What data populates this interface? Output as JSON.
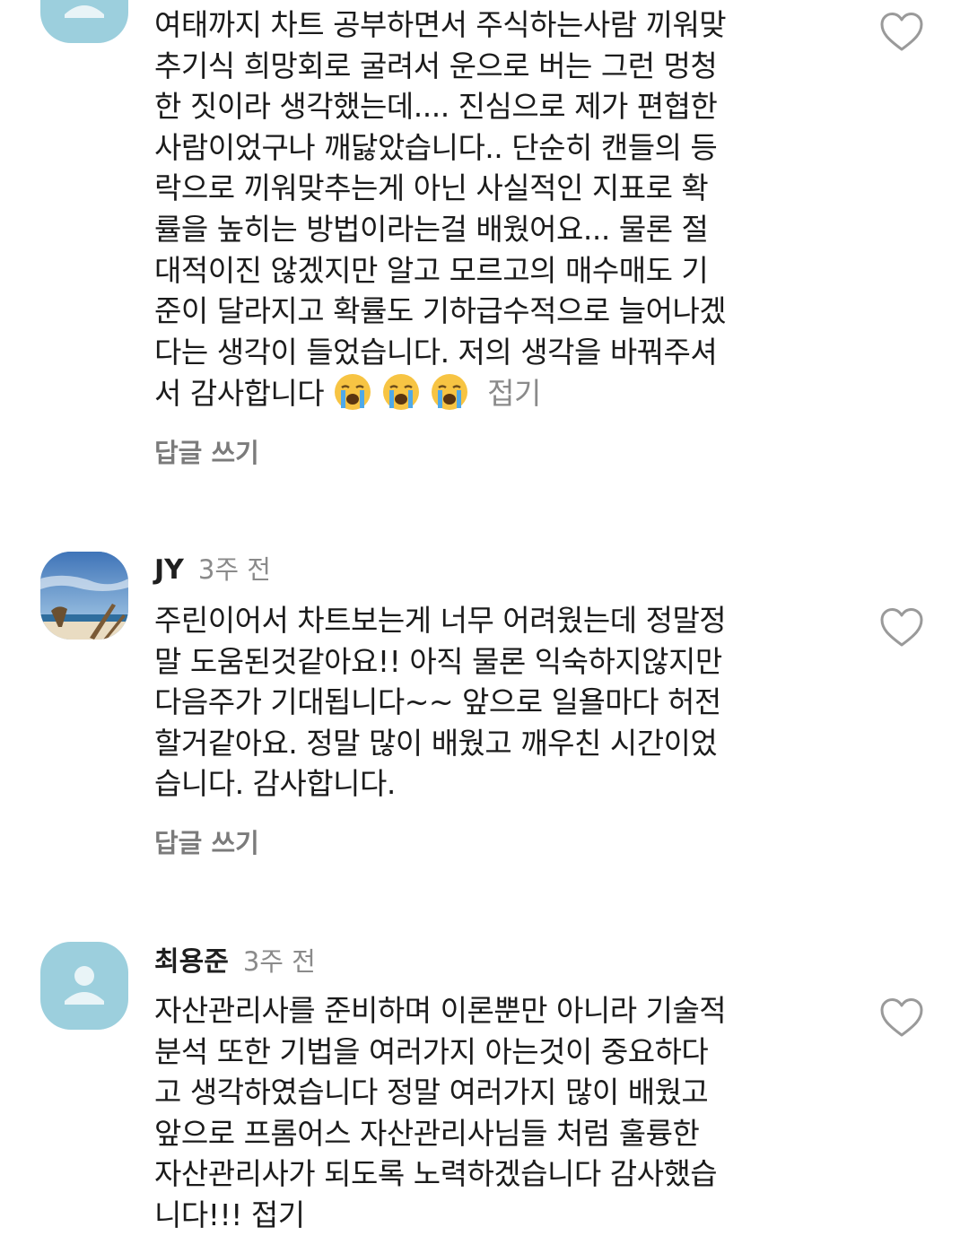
{
  "comments": [
    {
      "author": "",
      "time": "",
      "avatar": "default-person",
      "lines": [
        "여태까지 차트 공부하면서 주식하는사람 끼워맞",
        "추기식 희망회로 굴려서 운으로 버는 그런 멍청",
        "한 짓이라 생각했는데.... 진심으로 제가 편협한",
        "사람이었구나 깨닳았습니다.. 단순히 캔들의 등",
        "락으로 끼워맞추는게 아닌 사실적인 지표로 확",
        "률을 높히는 방법이라는걸 배웠어요... 물론 절",
        "대적이진 않겠지만 알고 모르고의 매수매도 기",
        "준이 달라지고 확률도 기하급수적으로 늘어나겠",
        "다는 생각이 들었습니다. 저의 생각을 바꿔주셔",
        "서 감사합니다"
      ],
      "collapse_label": "접기",
      "reply_label": "답글 쓰기"
    },
    {
      "author": "JY",
      "time": "3주 전",
      "avatar": "beach-photo",
      "lines": [
        "주린이어서 차트보는게 너무 어려웠는데 정말정",
        "말 도움된것같아요!! 아직 물론 익숙하지않지만",
        "다음주가 기대됩니다~~ 앞으로 일욜마다 허전",
        "할거같아요. 정말 많이 배웠고 깨우친 시간이었",
        "습니다. 감사합니다."
      ],
      "reply_label": "답글 쓰기"
    },
    {
      "author": "최용준",
      "time": "3주 전",
      "avatar": "default-person",
      "lines": [
        "자산관리사를 준비하며 이론뿐만 아니라 기술적",
        "분석 또한 기법을 여러가지 아는것이 중요하다",
        "고 생각하였습니다 정말 여러가지 많이 배웠고",
        "앞으로 프롬어스 자산관리사님들 처럼 훌륭한",
        "자산관리사가 되도록 노력하겠습니다 감사했습",
        "니다!!! 접기"
      ]
    }
  ],
  "colors": {
    "avatar_bg": "#9ccfdd",
    "secondary_text": "#8a8a8a",
    "reply_text": "#7b7b7b",
    "heart_stroke": "#9a9a9a"
  },
  "icons": {
    "like": "heart-outline-icon",
    "emoji": "loudly-crying-face"
  }
}
